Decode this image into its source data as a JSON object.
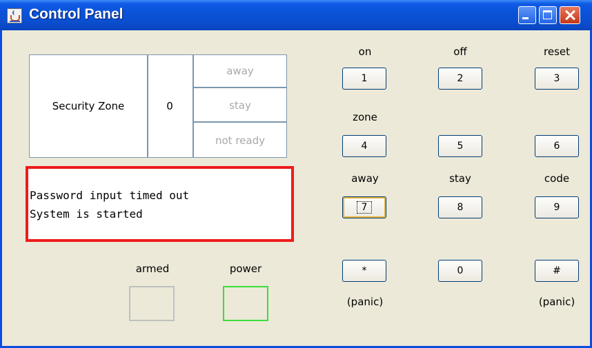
{
  "window": {
    "title": "Control Panel"
  },
  "zone": {
    "label": "Security Zone",
    "number": "0",
    "statuses": [
      "away",
      "stay",
      "not ready"
    ]
  },
  "messages": [
    "Password input timed out",
    "System is started"
  ],
  "indicators": {
    "armed_label": "armed",
    "power_label": "power"
  },
  "keypad": {
    "top_labels": [
      "on",
      "off",
      "reset"
    ],
    "zone_label": "zone",
    "mid_labels": [
      "away",
      "stay",
      "code"
    ],
    "keys": [
      "1",
      "2",
      "3",
      "4",
      "5",
      "6",
      "7",
      "8",
      "9",
      "*",
      "0",
      "#"
    ],
    "panic_left": "(panic)",
    "panic_right": "(panic)"
  },
  "colors": {
    "message_border": "#ee1b1b",
    "power_lamp_border": "#3bdc3b",
    "armed_lamp_border": "#c0c0c0"
  }
}
